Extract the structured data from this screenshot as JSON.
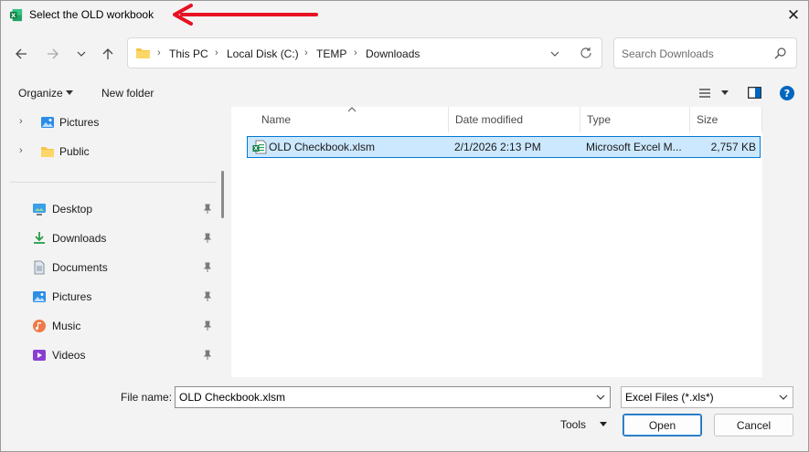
{
  "window": {
    "title": "Select the OLD workbook",
    "close_glyph": "✕"
  },
  "nav": {
    "breadcrumb": [
      "This PC",
      "Local Disk (C:)",
      "TEMP",
      "Downloads"
    ],
    "search_placeholder": "Search Downloads"
  },
  "toolbar": {
    "organize": "Organize",
    "new_folder": "New folder"
  },
  "sidebar": {
    "tree": [
      {
        "label": "Pictures",
        "icon": "pictures-icon"
      },
      {
        "label": "Public",
        "icon": "folder-icon"
      }
    ],
    "quick_access": [
      {
        "label": "Desktop",
        "icon": "desktop-icon"
      },
      {
        "label": "Downloads",
        "icon": "downloads-icon"
      },
      {
        "label": "Documents",
        "icon": "documents-icon"
      },
      {
        "label": "Pictures",
        "icon": "pictures-icon"
      },
      {
        "label": "Music",
        "icon": "music-icon"
      },
      {
        "label": "Videos",
        "icon": "videos-icon"
      }
    ]
  },
  "files": {
    "columns": [
      "Name",
      "Date modified",
      "Type",
      "Size"
    ],
    "rows": [
      {
        "name": "OLD Checkbook.xlsm",
        "date": "2/1/2026 2:13 PM",
        "type": "Microsoft Excel M...",
        "size": "2,757 KB",
        "selected": true
      }
    ]
  },
  "footer": {
    "file_name_label": "File name:",
    "file_name_value": "OLD Checkbook.xlsm",
    "file_type_value": "Excel Files (*.xls*)",
    "tools": "Tools",
    "open": "Open",
    "cancel": "Cancel"
  },
  "colors": {
    "accent": "#0078d4",
    "selection": "#cce8ff",
    "annotation_arrow": "#e81123",
    "excel_green": "#1d6f42",
    "help_blue": "#0067c0"
  }
}
